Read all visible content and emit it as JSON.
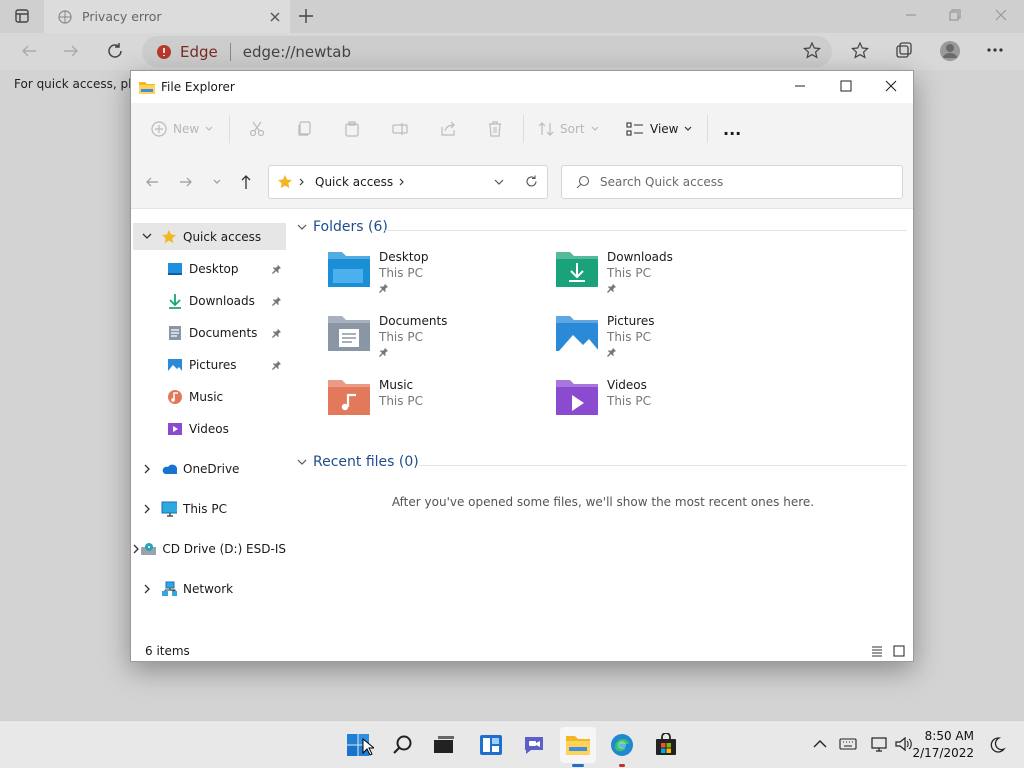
{
  "browser": {
    "tab_title": "Privacy error",
    "edge_label": "Edge",
    "url": "edge://newtab",
    "favorites_bar_text": "For quick access, plac"
  },
  "explorer": {
    "window_title": "File Explorer",
    "toolbar": {
      "new_label": "New",
      "sort_label": "Sort",
      "view_label": "View",
      "more_label": "..."
    },
    "breadcrumb": "Quick access",
    "search_placeholder": "Search Quick access",
    "nav": {
      "quick_access": "Quick access",
      "items": [
        {
          "label": "Desktop",
          "icon": "desktop-icon",
          "pinned": true
        },
        {
          "label": "Downloads",
          "icon": "downloads-icon",
          "pinned": true
        },
        {
          "label": "Documents",
          "icon": "documents-icon",
          "pinned": true
        },
        {
          "label": "Pictures",
          "icon": "pictures-icon",
          "pinned": true
        },
        {
          "label": "Music",
          "icon": "music-icon",
          "pinned": false
        },
        {
          "label": "Videos",
          "icon": "videos-icon",
          "pinned": false
        }
      ],
      "roots": [
        {
          "label": "OneDrive",
          "icon": "onedrive-icon"
        },
        {
          "label": "This PC",
          "icon": "this-pc-icon"
        },
        {
          "label": "CD Drive (D:) ESD-IS",
          "icon": "cd-drive-icon"
        },
        {
          "label": "Network",
          "icon": "network-icon"
        }
      ]
    },
    "folders_header": "Folders (6)",
    "folders": [
      {
        "name": "Desktop",
        "location": "This PC",
        "pinned": true,
        "color": "#1a8fd6"
      },
      {
        "name": "Downloads",
        "location": "This PC",
        "pinned": true,
        "color": "#1aa37a"
      },
      {
        "name": "Documents",
        "location": "This PC",
        "pinned": true,
        "color": "#8a96a6"
      },
      {
        "name": "Pictures",
        "location": "This PC",
        "pinned": true,
        "color": "#2a8ad8"
      },
      {
        "name": "Music",
        "location": "This PC",
        "pinned": false,
        "color": "#e2795a"
      },
      {
        "name": "Videos",
        "location": "This PC",
        "pinned": false,
        "color": "#8a4bd0"
      }
    ],
    "recent_header": "Recent files (0)",
    "recent_empty": "After you've opened some files, we'll show the most recent ones here.",
    "status_items": "6 items"
  },
  "taskbar": {
    "time": "8:50 AM",
    "date": "2/17/2022"
  },
  "colors": {
    "accent": "#1f4e8c",
    "folder_yellow": "#f2b824",
    "selection": "#e6e6e6"
  }
}
